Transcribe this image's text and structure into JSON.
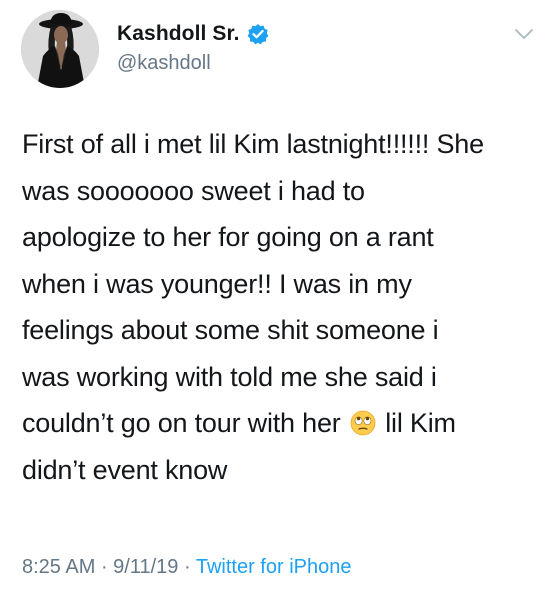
{
  "author": {
    "display_name": "Kashdoll Sr.",
    "handle": "@kashdoll",
    "verified": true,
    "avatar_icon": "profile-photo-avatar"
  },
  "tweet": {
    "lines": [
      "First of all i met lil Kim lastnight!!!!!! She",
      "was sooooooo sweet i had to",
      "apologize to her for going on a rant",
      "when i was younger!! I was in my",
      "feelings about some shit someone i",
      "was working with told me she said i",
      "couldn’t go on tour with her",
      "lil Kim",
      "didn’t event know"
    ],
    "emoji_icon": "face-with-rolling-eyes-emoji"
  },
  "meta": {
    "time": "8:25 AM",
    "date": "9/11/19",
    "separator": " · ",
    "source": "Twitter for iPhone"
  },
  "colors": {
    "text": "#14171a",
    "secondary": "#657786",
    "accent": "#1da1f2"
  }
}
